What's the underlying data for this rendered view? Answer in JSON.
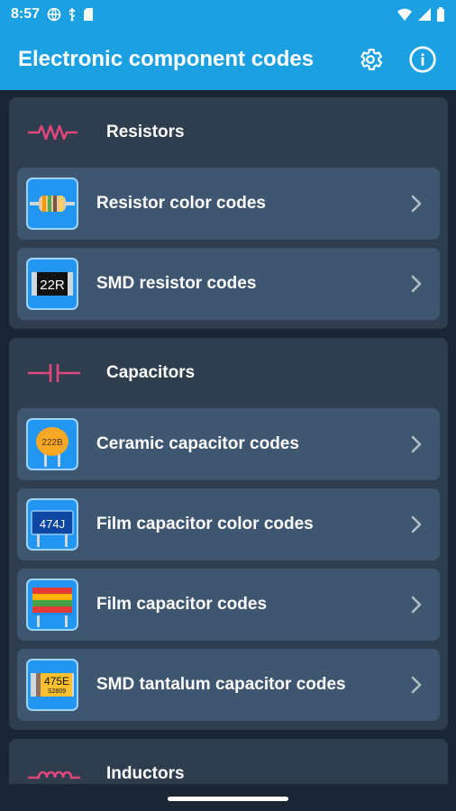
{
  "status_bar": {
    "time": "8:57",
    "left_icons": [
      "vpn-globe-icon",
      "usb-icon",
      "sd-card-icon"
    ],
    "right_icons": [
      "wifi-icon",
      "cellular-signal-icon",
      "battery-icon"
    ]
  },
  "app_bar": {
    "title": "Electronic component codes",
    "actions": [
      "gear-icon",
      "info-icon"
    ]
  },
  "colors": {
    "accent": "#1ba1e2",
    "background": "#1a2633",
    "section_bg": "#2f3e4f",
    "item_bg": "#3f5670",
    "symbol_pink": "#e0457b",
    "icon_bg": "#2196f3"
  },
  "sections": [
    {
      "title": "Resistors",
      "symbol": "resistor-symbol-icon",
      "items": [
        {
          "label": "Resistor color codes",
          "icon": "resistor-color-icon"
        },
        {
          "label": "SMD resistor codes",
          "icon": "smd-resistor-icon",
          "icon_text": "22R"
        }
      ]
    },
    {
      "title": "Capacitors",
      "symbol": "capacitor-symbol-icon",
      "items": [
        {
          "label": "Ceramic capacitor codes",
          "icon": "ceramic-capacitor-icon",
          "icon_text": "222B"
        },
        {
          "label": "Film capacitor color codes",
          "icon": "film-capacitor-icon",
          "icon_text": "474J"
        },
        {
          "label": "Film capacitor codes",
          "icon": "film-capacitor-color-icon"
        },
        {
          "label": "SMD tantalum capacitor codes",
          "icon": "tantalum-capacitor-icon",
          "icon_text": "475E",
          "icon_subtext": "S2809"
        }
      ]
    },
    {
      "title": "Inductors",
      "symbol": "inductor-symbol-icon",
      "items": []
    }
  ]
}
